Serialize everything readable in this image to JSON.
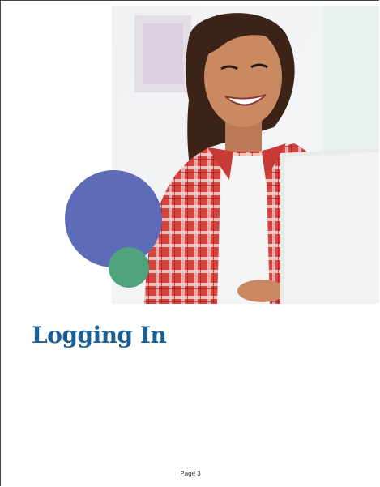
{
  "document": {
    "title": "Logging In",
    "page_label": "Page 3"
  },
  "colors": {
    "title": "#1a5e96",
    "circle_blue": "#5e6bb8",
    "circle_green": "#4fa37d"
  },
  "photo": {
    "icon": "photo-of-smiling-student-at-laptop"
  }
}
